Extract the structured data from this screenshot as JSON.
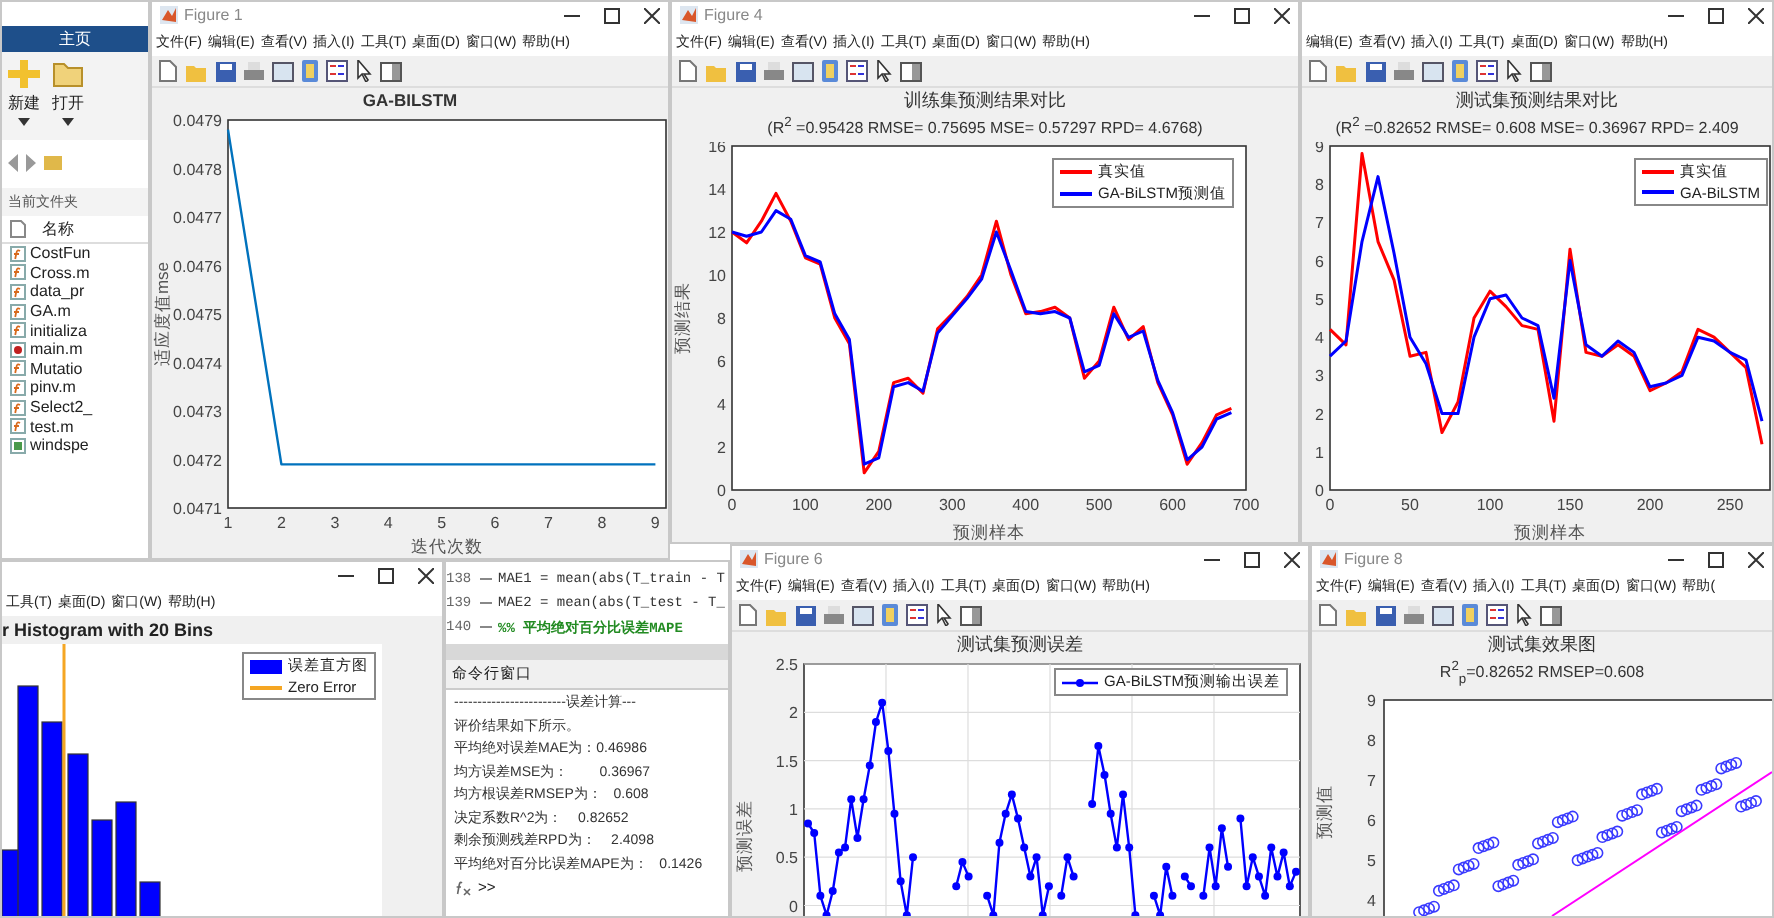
{
  "matlab": {
    "home_tab": "主页",
    "tools": [
      {
        "label": "新建",
        "kind": "new"
      },
      {
        "label": "打开",
        "kind": "open"
      }
    ],
    "folder_label": "当前文件夹",
    "name_column": "名称",
    "files": [
      {
        "name": "CostFun",
        "kind": "function"
      },
      {
        "name": "Cross.m",
        "kind": "function"
      },
      {
        "name": "data_pr",
        "kind": "function"
      },
      {
        "name": "GA.m",
        "kind": "function"
      },
      {
        "name": "initializa",
        "kind": "function"
      },
      {
        "name": "main.m",
        "kind": "script"
      },
      {
        "name": "Mutatio",
        "kind": "function"
      },
      {
        "name": "pinv.m",
        "kind": "function"
      },
      {
        "name": "Select2_",
        "kind": "function"
      },
      {
        "name": "test.m",
        "kind": "function"
      },
      {
        "name": "windspe",
        "kind": "data"
      }
    ]
  },
  "figures": [
    {
      "kind": "line",
      "title": "Figure 1",
      "menu": [
        "文件(F)",
        "编辑(E)",
        "查看(V)",
        "插入(I)",
        "工具(T)",
        "桌面(D)",
        "窗口(W)",
        "帮助(H)"
      ],
      "chart_data": {
        "type": "line",
        "title": "GA-BILSTM",
        "xlabel": "迭代次数",
        "ylabel": "适应度值mse",
        "x": [
          1,
          2,
          3,
          4,
          5,
          6,
          7,
          8,
          9
        ],
        "xlim": [
          1,
          9.2
        ],
        "ylim": [
          0.0471,
          0.0479
        ],
        "xticks": [
          1,
          2,
          3,
          4,
          5,
          6,
          7,
          8,
          9
        ],
        "yticks": [
          0.0471,
          0.0472,
          0.0473,
          0.0474,
          0.0475,
          0.0476,
          0.0477,
          0.0478,
          0.0479
        ],
        "series": [
          {
            "color": "#0072bd",
            "values": [
              0.04788,
              0.04719,
              0.04719,
              0.04719,
              0.04719,
              0.04719,
              0.04719,
              0.04719,
              0.04719
            ]
          }
        ]
      }
    },
    {
      "kind": "line",
      "title": "Figure 4",
      "menu": [
        "文件(F)",
        "编辑(E)",
        "查看(V)",
        "插入(I)",
        "工具(T)",
        "桌面(D)",
        "窗口(W)",
        "帮助(H)"
      ],
      "subtitle": "(R$^{2}$ =0.95428 RMSE= 0.75695 MSE= 0.57297 RPD= 4.6768)",
      "chart_data": {
        "type": "line",
        "legend": "upper right",
        "title": "训练集预测结果对比",
        "xlabel": "预测样本",
        "ylabel": "预测结果",
        "x": [
          0,
          20,
          40,
          60,
          80,
          100,
          120,
          140,
          160,
          180,
          200,
          220,
          240,
          260,
          280,
          300,
          320,
          340,
          360,
          380,
          400,
          420,
          440,
          460,
          480,
          500,
          520,
          540,
          560,
          580,
          600,
          620,
          640,
          660,
          680
        ],
        "xlim": [
          0,
          700
        ],
        "ylim": [
          0,
          16
        ],
        "xticks": [
          0,
          100,
          200,
          300,
          400,
          500,
          600,
          700
        ],
        "yticks": [
          0,
          2,
          4,
          6,
          8,
          10,
          12,
          14,
          16
        ],
        "series": [
          {
            "name": "真实值",
            "color": "#ff0000",
            "values": [
              12,
              11.5,
              12.5,
              13.8,
              12.5,
              10.8,
              10.5,
              8,
              6.8,
              0.8,
              1.8,
              5,
              5.2,
              4.5,
              7.5,
              8.2,
              9,
              10,
              12.5,
              10,
              8.2,
              8.3,
              8.5,
              8,
              5.2,
              6,
              8.5,
              7,
              7.6,
              5,
              3.5,
              1.2,
              2.2,
              3.5,
              3.8
            ]
          },
          {
            "name": "GA-BiLSTM预测值",
            "color": "#0000ff",
            "values": [
              12,
              11.8,
              12,
              13,
              12.6,
              10.9,
              10.6,
              8.2,
              7,
              1.2,
              1.5,
              4.8,
              5,
              4.6,
              7.3,
              8.1,
              8.9,
              9.8,
              12,
              10.2,
              8.3,
              8.2,
              8.3,
              8,
              5.5,
              5.8,
              8.2,
              7.1,
              7.4,
              5.1,
              3.6,
              1.4,
              2,
              3.3,
              3.6
            ]
          }
        ]
      }
    },
    {
      "kind": "line",
      "menu": [
        "编辑(E)",
        "查看(V)",
        "插入(I)",
        "工具(T)",
        "桌面(D)",
        "窗口(W)",
        "帮助(H)"
      ],
      "subtitle": "(R$^{2}$ =0.82652 RMSE= 0.608 MSE= 0.36967 RPD= 2.409",
      "chart_data": {
        "type": "line",
        "legend": "upper right",
        "title": "测试集预测结果对比",
        "xlabel": "预测样本",
        "x": [
          0,
          10,
          20,
          30,
          40,
          50,
          60,
          70,
          80,
          90,
          100,
          110,
          120,
          130,
          140,
          150,
          160,
          170,
          180,
          190,
          200,
          210,
          220,
          230,
          240,
          250,
          260,
          270
        ],
        "xlim": [
          0,
          275
        ],
        "ylim": [
          0,
          9
        ],
        "xticks": [
          0,
          50,
          100,
          150,
          200,
          250
        ],
        "yticks": [
          0,
          1,
          2,
          3,
          4,
          5,
          6,
          7,
          8,
          9
        ],
        "series": [
          {
            "name": "真实值",
            "color": "#ff0000",
            "values": [
              4.2,
              3.8,
              8.8,
              6.5,
              5.5,
              3.5,
              3.6,
              1.5,
              2.3,
              4.5,
              5.2,
              4.8,
              4.3,
              4.2,
              1.8,
              6.3,
              3.6,
              3.5,
              3.8,
              3.5,
              2.6,
              2.8,
              3.1,
              4.2,
              4.0,
              3.6,
              3.2,
              1.2
            ]
          },
          {
            "name": "GA-BiLSTM",
            "color": "#0000ff",
            "values": [
              3.5,
              3.9,
              6.5,
              8.2,
              6.2,
              4.0,
              3.3,
              2.0,
              2.0,
              4.0,
              5.0,
              5.1,
              4.5,
              4.3,
              2.4,
              6.0,
              3.8,
              3.5,
              3.9,
              3.6,
              2.7,
              2.8,
              3.0,
              4.0,
              3.9,
              3.6,
              3.4,
              1.8
            ]
          }
        ]
      }
    },
    {
      "kind": "histogram",
      "menu": [
        "工具(T)",
        "桌面(D)",
        "窗口(W)",
        "帮助(H)"
      ],
      "chart_title": "r Histogram with 20 Bins",
      "legend": [
        {
          "label": "误差直方图",
          "color": "#0000ff"
        },
        {
          "label": "Zero Error",
          "color": "#f5a623"
        }
      ]
    },
    {
      "kind": "error",
      "title": "Figure 6",
      "menu": [
        "文件(F)",
        "编辑(E)",
        "查看(V)",
        "插入(I)",
        "工具(T)",
        "桌面(D)",
        "窗口(W)",
        "帮助(H)"
      ],
      "chart_data": {
        "type": "line",
        "legend": "upper right",
        "grid": true,
        "title": "测试集预测误差",
        "ylabel": "预测误差",
        "ylim": [
          -0.15,
          2.5
        ],
        "yticks": [
          0,
          0.5,
          1,
          1.5,
          2,
          2.5
        ],
        "series": [
          {
            "name": "GA-BiLSTM预测输出误差",
            "color": "#0000ff",
            "marker": "o",
            "values": [
              0.85,
              0.75,
              0.1,
              -0.1,
              0.15,
              0.55,
              0.6,
              1.1,
              0.7,
              1.1,
              1.45,
              1.9,
              2.1,
              1.6,
              0.95,
              0.25,
              -0.1,
              0.5,
              null,
              null,
              null,
              null,
              null,
              null,
              0.2,
              0.45,
              0.3,
              null,
              null,
              0.1,
              -0.1,
              0.65,
              0.95,
              1.15,
              0.9,
              0.6,
              0.3,
              0.5,
              -0.1,
              0.2,
              null,
              0.1,
              0.5,
              0.3,
              null,
              null,
              1.05,
              1.65,
              1.35,
              0.95,
              0.6,
              1.15,
              0.6,
              -0.1,
              null,
              null,
              0.1,
              -0.1,
              0.4,
              0.1,
              null,
              0.3,
              0.2,
              null,
              0.1,
              0.6,
              0.2,
              0.8,
              0.4,
              null,
              0.9,
              0.2,
              0.5,
              0.3,
              0.1,
              0.6,
              0.3,
              0.55,
              0.2,
              0.35
            ]
          }
        ]
      }
    },
    {
      "kind": "scatter",
      "title": "Figure 8",
      "menu": [
        "文件(F)",
        "编辑(E)",
        "查看(V)",
        "插入(I)",
        "工具(T)",
        "桌面(D)",
        "窗口(W)",
        "帮助("
      ],
      "chart_title": "测试集效果图",
      "subtitle": "R$^{2}$$_{p}$=0.82652  RMSEP=0.608",
      "ylabel": "预测值",
      "y_ticks": [
        "9",
        "8",
        "7",
        "6",
        "5",
        "4"
      ]
    }
  ],
  "editor": {
    "lines": [
      {
        "number": "138",
        "text": "MAE1 = mean(abs(T_train - T",
        "kind": "code"
      },
      {
        "number": "139",
        "text": "MAE2 = mean(abs(T_test - T_",
        "kind": "code"
      },
      {
        "number": "140",
        "text": "%% 平均绝对百分比误差MAPE",
        "kind": "comment"
      }
    ],
    "command_title": "命令行窗口",
    "output": [
      "------------------------误差计算---",
      "评价结果如下所示。",
      "平均绝对误差MAE为：0.46986",
      "均方误差MSE为：        0.36967",
      "均方根误差RMSEP为：   0.608",
      "决定系数R^2为：    0.82652",
      "剩余预测残差RPD为：    2.4098",
      "平均绝对百分比误差MAPE为：   0.1426"
    ],
    "prompt": ">>"
  }
}
